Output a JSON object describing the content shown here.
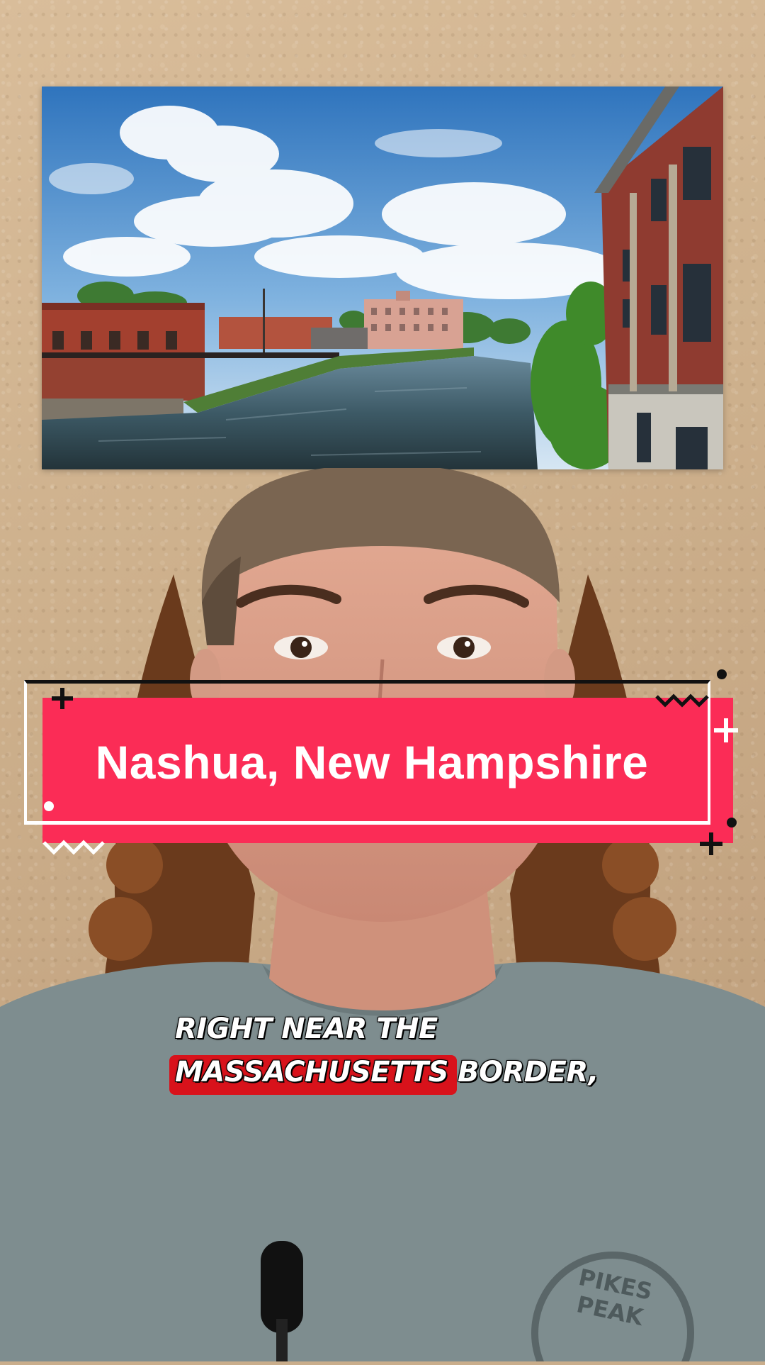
{
  "title_banner": {
    "text": "Nashua, New Hampshire",
    "color": "#fb2c56"
  },
  "captions": {
    "line1": "RIGHT NEAR THE",
    "line2_highlight": "MASSACHUSETTS",
    "line2_rest": "BORDER,",
    "highlight_color": "#d8121b"
  },
  "shirt_logo": "PIKES PEAK",
  "icons": [
    "plus-icon",
    "zigzag-icon",
    "dot-icon",
    "microphone-icon"
  ]
}
